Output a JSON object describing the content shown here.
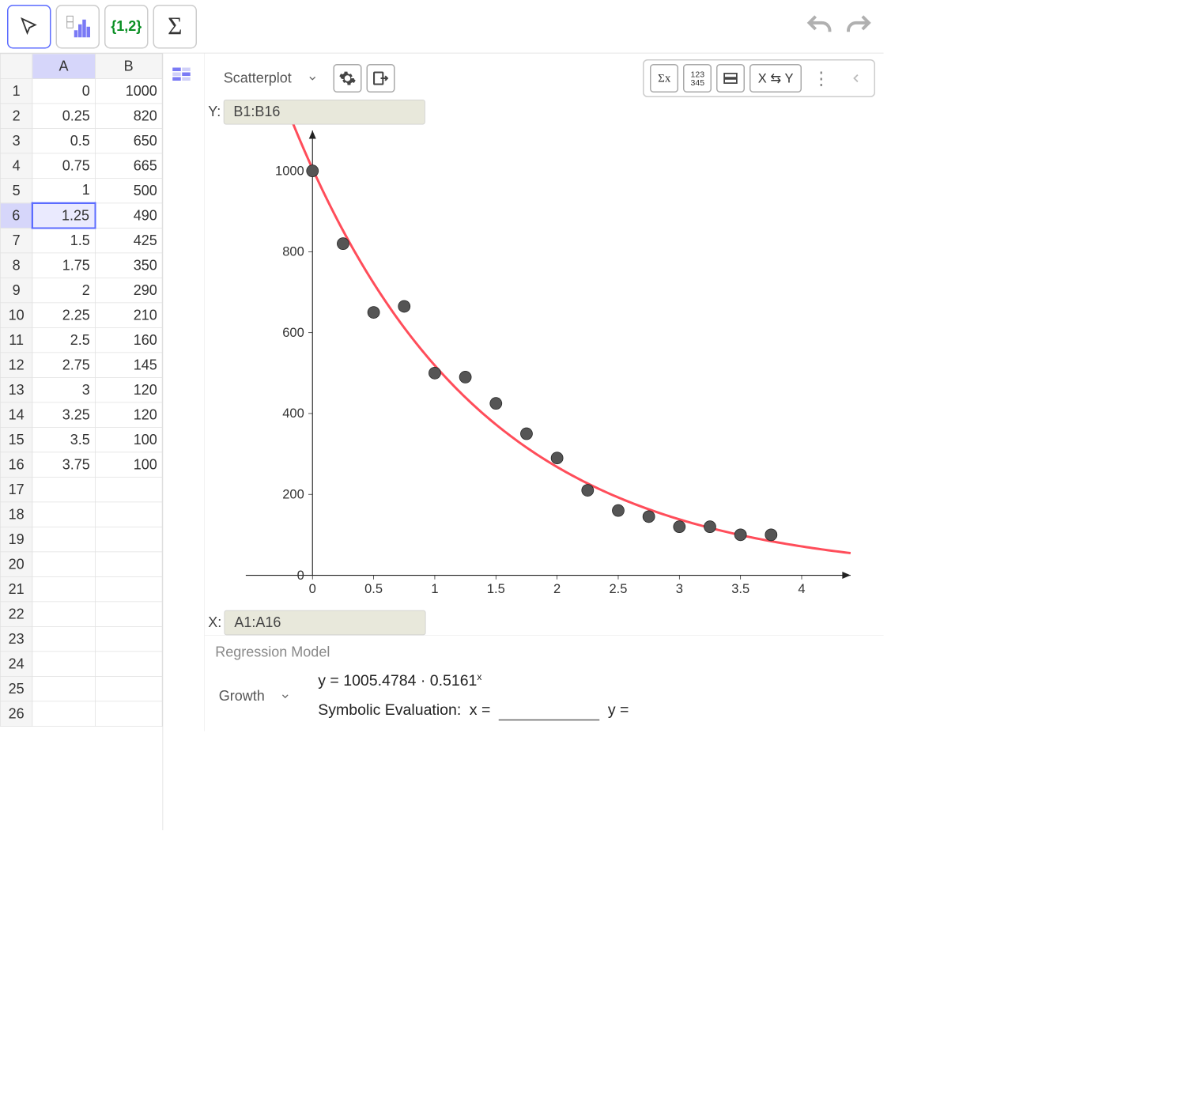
{
  "toolbar": {
    "list_label": "{1,2}",
    "sigma_label": "Σ"
  },
  "spreadsheet": {
    "columns": [
      "A",
      "B"
    ],
    "selected_col": "A",
    "selected_cell": {
      "row": 6,
      "col": "A"
    },
    "row_count": 26,
    "rows": [
      {
        "n": 1,
        "A": "0",
        "B": "1000"
      },
      {
        "n": 2,
        "A": "0.25",
        "B": "820"
      },
      {
        "n": 3,
        "A": "0.5",
        "B": "650"
      },
      {
        "n": 4,
        "A": "0.75",
        "B": "665"
      },
      {
        "n": 5,
        "A": "1",
        "B": "500"
      },
      {
        "n": 6,
        "A": "1.25",
        "B": "490"
      },
      {
        "n": 7,
        "A": "1.5",
        "B": "425"
      },
      {
        "n": 8,
        "A": "1.75",
        "B": "350"
      },
      {
        "n": 9,
        "A": "2",
        "B": "290"
      },
      {
        "n": 10,
        "A": "2.25",
        "B": "210"
      },
      {
        "n": 11,
        "A": "2.5",
        "B": "160"
      },
      {
        "n": 12,
        "A": "2.75",
        "B": "145"
      },
      {
        "n": 13,
        "A": "3",
        "B": "120"
      },
      {
        "n": 14,
        "A": "3.25",
        "B": "120"
      },
      {
        "n": 15,
        "A": "3.5",
        "B": "100"
      },
      {
        "n": 16,
        "A": "3.75",
        "B": "100"
      }
    ]
  },
  "chart": {
    "type_label": "Scatterplot",
    "y_prefix": "Y:",
    "y_range": "B1:B16",
    "x_prefix": "X:",
    "x_range": "A1:A16",
    "swap_label": "X ⇆ Y"
  },
  "regression": {
    "title": "Regression Model",
    "model_label": "Growth",
    "equation_html": "y = 1005.4784 · 0.5161<sup>x</sup>",
    "eval_label": "Symbolic Evaluation:",
    "x_label": "x =",
    "y_label": "y ="
  },
  "chart_data": {
    "type": "scatter",
    "title": "",
    "xlabel": "",
    "ylabel": "",
    "xlim": [
      -0.4,
      4.4
    ],
    "ylim": [
      0,
      1100
    ],
    "x_ticks": [
      0,
      0.5,
      1,
      1.5,
      2,
      2.5,
      3,
      3.5,
      4
    ],
    "y_ticks": [
      0,
      200,
      400,
      600,
      800,
      1000
    ],
    "series": [
      {
        "name": "data",
        "render": "points",
        "color": "#555555",
        "x": [
          0,
          0.25,
          0.5,
          0.75,
          1,
          1.25,
          1.5,
          1.75,
          2,
          2.25,
          2.5,
          2.75,
          3,
          3.25,
          3.5,
          3.75
        ],
        "y": [
          1000,
          820,
          650,
          665,
          500,
          490,
          425,
          350,
          290,
          210,
          160,
          145,
          120,
          120,
          100,
          100
        ]
      },
      {
        "name": "fit",
        "render": "line",
        "color": "#ff4d5a",
        "formula": "1005.4784 * 0.5161^x"
      }
    ]
  }
}
